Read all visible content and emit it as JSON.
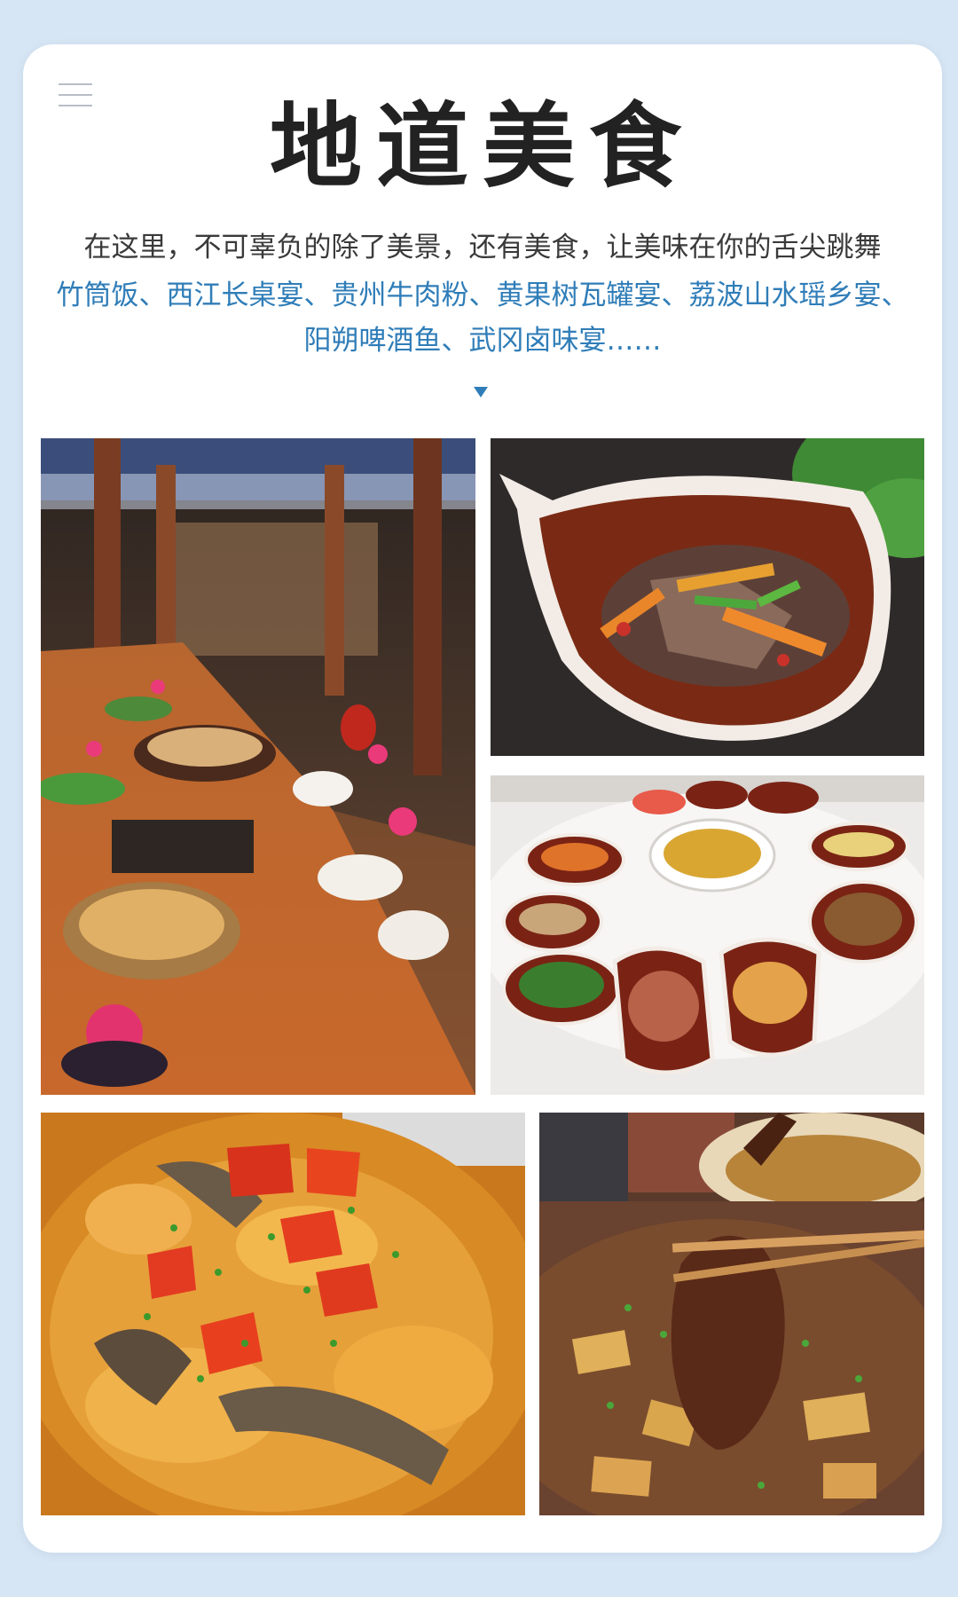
{
  "header": {
    "menu_icon": "menu-icon",
    "title": "地道美食"
  },
  "intro": {
    "text": "在这里，不可辜负的除了美景，还有美食，让美味在你的舌尖跳舞",
    "dishes_line_1": "竹筒饭、西江长桌宴、贵州牛肉粉、黄果树瓦罐宴、荔波山水瑶乡宴、",
    "dishes_line_2": "阳朔啤酒鱼、武冈卤味宴……"
  },
  "colors": {
    "background": "#d7e6f4",
    "card": "#ffffff",
    "title": "#222222",
    "body_text": "#3a3a3a",
    "accent": "#2f7db8"
  },
  "gallery": {
    "indicator_icon": "triangle-down-icon",
    "photos": [
      "long-table-banquet-photo",
      "fish-shaped-clay-pot-dish-photo",
      "clay-pot-feast-table-photo",
      "braised-fish-with-tomato-photo",
      "braised-duck-with-chopsticks-photo"
    ]
  }
}
